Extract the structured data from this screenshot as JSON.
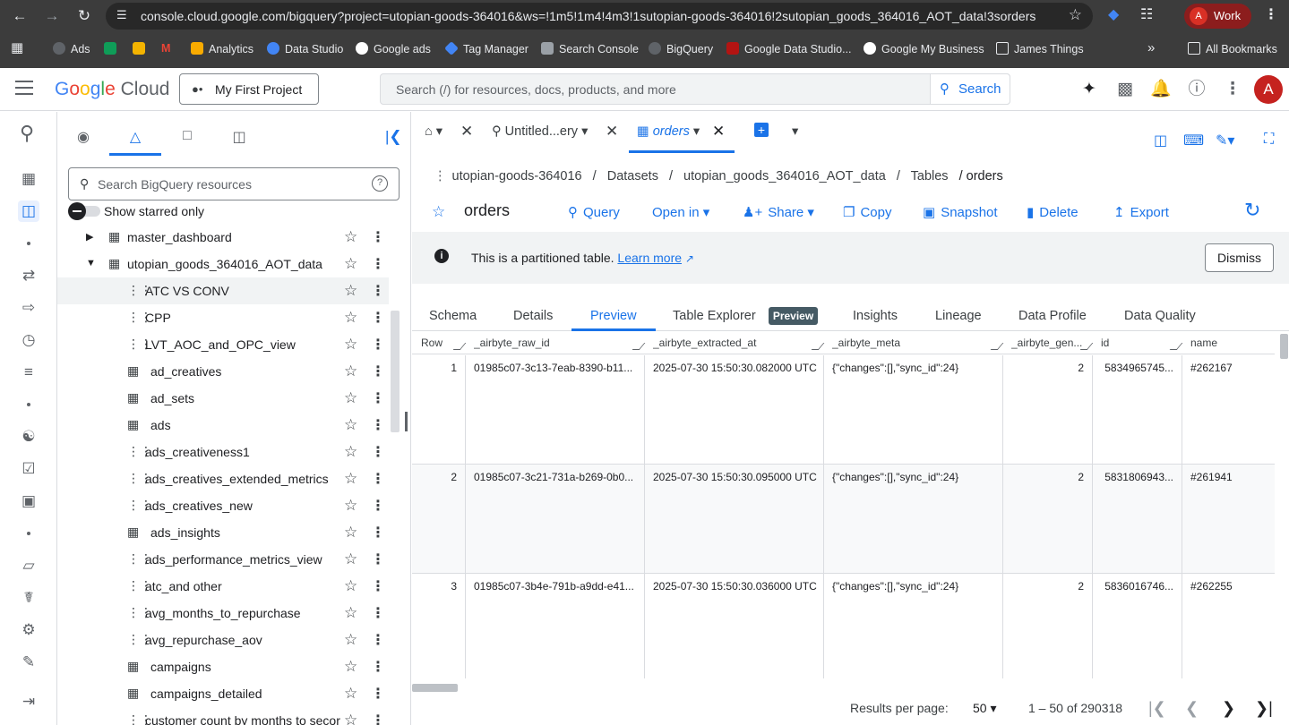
{
  "browser": {
    "url": "console.cloud.google.com/bigquery?project=utopian-goods-364016&ws=!1m5!1m4!4m3!1sutopian-goods-364016!2sutopian_goods_364016_AOT_data!3sorders",
    "profile_label": "Work",
    "profile_initial": "A",
    "bookmarks": [
      {
        "label": "Ads"
      },
      {
        "label": ""
      },
      {
        "label": ""
      },
      {
        "label": ""
      },
      {
        "label": "Analytics"
      },
      {
        "label": "Data Studio"
      },
      {
        "label": "Google ads"
      },
      {
        "label": "Tag Manager"
      },
      {
        "label": "Search Console"
      },
      {
        "label": "BigQuery"
      },
      {
        "label": "Google Data Studio..."
      },
      {
        "label": "Google My Business"
      },
      {
        "label": "James Things"
      }
    ],
    "more_bookmarks": "»",
    "all_bookmarks": "All Bookmarks"
  },
  "header": {
    "logo_google": "Google",
    "logo_cloud": "Cloud",
    "project": "My First Project",
    "search_placeholder": "Search (/) for resources, docs, products, and more",
    "search_button": "Search",
    "user_initial": "A"
  },
  "explorer": {
    "search_placeholder": "Search BigQuery resources",
    "starred_label": "Show starred only",
    "tree": [
      {
        "label": "master_dashboard",
        "type": "dataset",
        "expanded": false
      },
      {
        "label": "utopian_goods_364016_AOT_data",
        "type": "dataset",
        "expanded": true
      },
      {
        "label": "ATC VS CONV",
        "type": "view"
      },
      {
        "label": "CPP",
        "type": "view"
      },
      {
        "label": "LVT_AOC_and_OPC_view",
        "type": "view"
      },
      {
        "label": "ad_creatives",
        "type": "table"
      },
      {
        "label": "ad_sets",
        "type": "table"
      },
      {
        "label": "ads",
        "type": "table"
      },
      {
        "label": "ads_creativeness1",
        "type": "view"
      },
      {
        "label": "ads_creatives_extended_metrics",
        "type": "view"
      },
      {
        "label": "ads_creatives_new",
        "type": "view"
      },
      {
        "label": "ads_insights",
        "type": "table"
      },
      {
        "label": "ads_performance_metrics_view",
        "type": "view"
      },
      {
        "label": "atc_and other",
        "type": "view"
      },
      {
        "label": "avg_months_to_repurchase",
        "type": "view"
      },
      {
        "label": "avg_repurchase_aov",
        "type": "view"
      },
      {
        "label": "campaigns",
        "type": "table"
      },
      {
        "label": "campaigns_detailed",
        "type": "table"
      },
      {
        "label": "customer count by months to secor",
        "type": "view"
      }
    ]
  },
  "tabs": {
    "query_tab": "Untitled...ery",
    "active_tab": "orders"
  },
  "breadcrumb": {
    "project": "utopian-goods-364016",
    "sep": "/",
    "datasets": "Datasets",
    "dataset": "utopian_goods_364016_AOT_data",
    "tables": "Tables",
    "table": "/ orders"
  },
  "table_title": "orders",
  "actions": {
    "query": "Query",
    "open_in": "Open in",
    "share": "Share",
    "copy": "Copy",
    "snapshot": "Snapshot",
    "delete": "Delete",
    "export": "Export"
  },
  "banner": {
    "message": "This is a partitioned table.",
    "link": "Learn more",
    "dismiss": "Dismiss"
  },
  "detail_tabs": {
    "schema": "Schema",
    "details": "Details",
    "preview": "Preview",
    "table_explorer": "Table Explorer",
    "badge": "Preview",
    "insights": "Insights",
    "lineage": "Lineage",
    "data_profile": "Data Profile",
    "data_quality": "Data Quality"
  },
  "grid": {
    "columns": [
      "Row",
      "_airbyte_raw_id",
      "_airbyte_extracted_at",
      "_airbyte_meta",
      "_airbyte_gen...",
      "id",
      "name"
    ],
    "rows": [
      {
        "row": "1",
        "raw_id": "01985c07-3c13-7eab-8390-b11...",
        "extracted_at": "2025-07-30 15:50:30.082000 UTC",
        "meta": "{\"changes\":[],\"sync_id\":24}",
        "gen": "2",
        "id": "5834965745...",
        "name": "#262167"
      },
      {
        "row": "2",
        "raw_id": "01985c07-3c21-731a-b269-0b0...",
        "extracted_at": "2025-07-30 15:50:30.095000 UTC",
        "meta": "{\"changes\":[],\"sync_id\":24}",
        "gen": "2",
        "id": "5831806943...",
        "name": "#261941"
      },
      {
        "row": "3",
        "raw_id": "01985c07-3b4e-791b-a9dd-e41...",
        "extracted_at": "2025-07-30 15:50:30.036000 UTC",
        "meta": "{\"changes\":[],\"sync_id\":24}",
        "gen": "2",
        "id": "5836016746...",
        "name": "#262255"
      }
    ]
  },
  "pager": {
    "label": "Results per page:",
    "per_page": "50",
    "range": "1 – 50 of 290318"
  },
  "colors": {
    "accent": "#1a73e8",
    "chrome": "#3c3c3c",
    "banner": "#f1f3f4"
  }
}
